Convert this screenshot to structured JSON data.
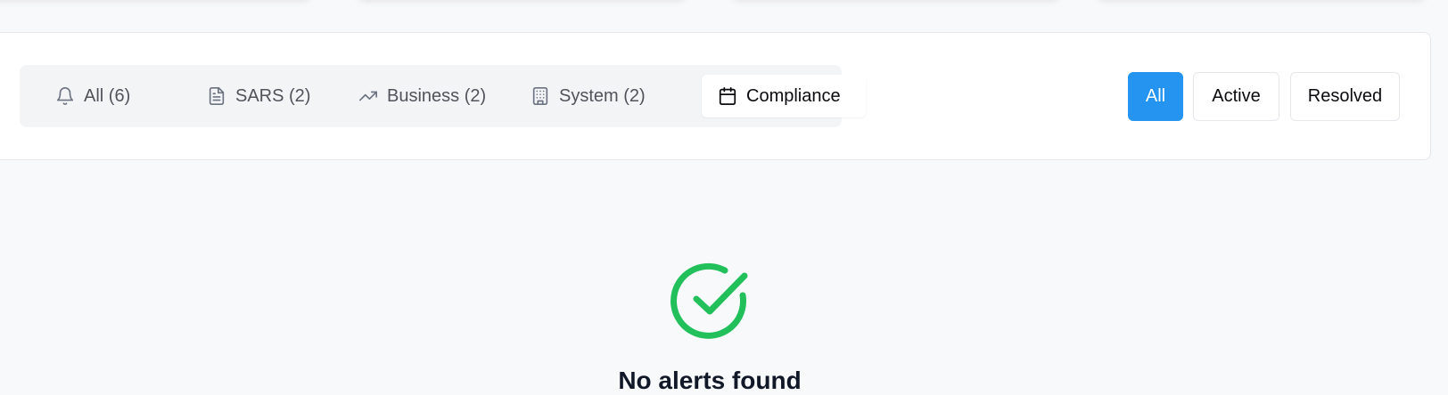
{
  "tabs": [
    {
      "label": "All (6)",
      "icon": "bell-icon",
      "active": false
    },
    {
      "label": "SARS (2)",
      "icon": "file-text-icon",
      "active": false
    },
    {
      "label": "Business (2)",
      "icon": "trending-up-icon",
      "active": false
    },
    {
      "label": "System (2)",
      "icon": "building-icon",
      "active": false
    },
    {
      "label": "Compliance",
      "icon": "calendar-icon",
      "active": true
    }
  ],
  "status_filters": [
    {
      "label": "All",
      "selected": true
    },
    {
      "label": "Active",
      "selected": false
    },
    {
      "label": "Resolved",
      "selected": false
    }
  ],
  "empty_state": {
    "icon": "check-circle-icon",
    "title": "No alerts found"
  },
  "colors": {
    "accent": "#2494f0",
    "success": "#22c05a",
    "background": "#f8f9fb"
  }
}
